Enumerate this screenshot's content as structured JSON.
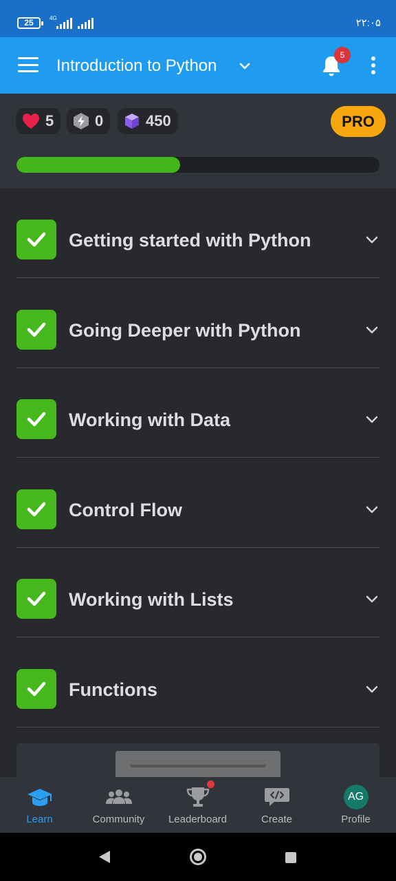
{
  "status_bar": {
    "battery": "25",
    "network": "4G",
    "time": "۲۲:۰۵"
  },
  "app_bar": {
    "title": "Introduction to Python",
    "notification_count": "5",
    "icons": [
      "menu-icon",
      "chevron-down-icon",
      "bell-icon",
      "more-vert-icon"
    ]
  },
  "stats": {
    "hearts": "5",
    "bolts": "0",
    "gems": "450",
    "pro_label": "PRO",
    "progress_fraction": 0.45,
    "colors": {
      "heart": "#e8204a",
      "gem": "#9b6ff0",
      "progress": "#44b51b",
      "pro": "#f7a80f"
    }
  },
  "modules": [
    {
      "label": "Getting started with Python",
      "completed": true
    },
    {
      "label": "Going Deeper with Python",
      "completed": true
    },
    {
      "label": "Working with Data",
      "completed": true
    },
    {
      "label": "Control Flow",
      "completed": true
    },
    {
      "label": "Working with Lists",
      "completed": true
    },
    {
      "label": "Functions",
      "completed": true
    }
  ],
  "bottom_nav": {
    "tabs": [
      {
        "label": "Learn",
        "icon": "graduation-cap-icon",
        "active": true
      },
      {
        "label": "Community",
        "icon": "people-icon",
        "active": false
      },
      {
        "label": "Leaderboard",
        "icon": "trophy-icon",
        "active": false
      },
      {
        "label": "Create",
        "icon": "code-bubble-icon",
        "active": false
      },
      {
        "label": "Profile",
        "icon": "avatar",
        "active": false
      }
    ],
    "avatar_initials": "AG",
    "accent": "#2b9ef2"
  }
}
